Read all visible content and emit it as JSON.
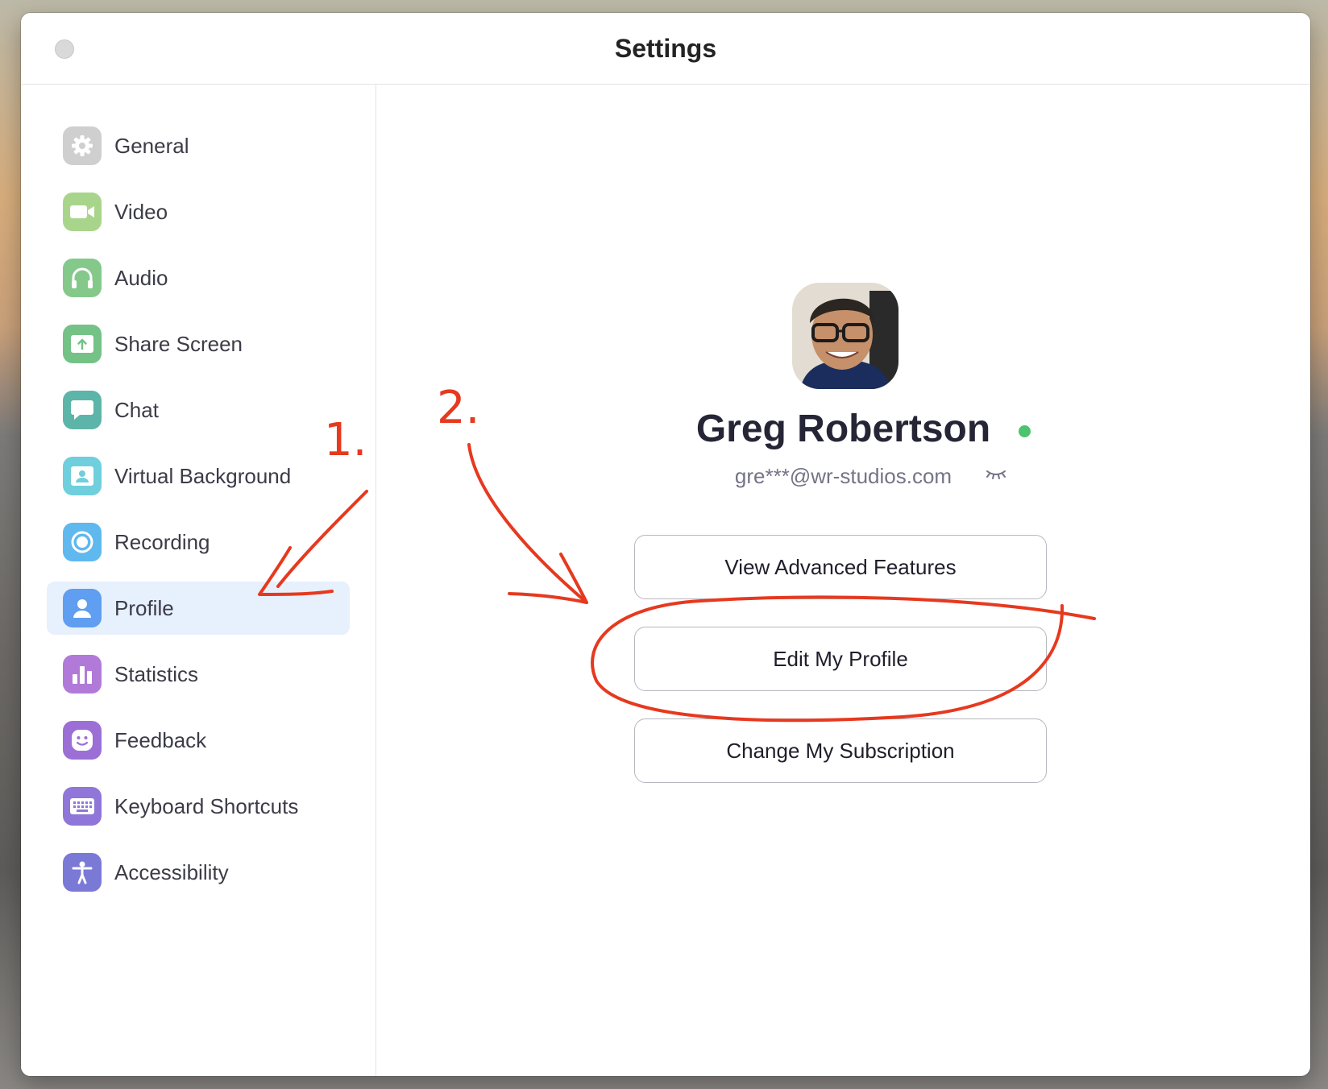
{
  "window": {
    "title": "Settings"
  },
  "sidebar": {
    "items": [
      {
        "label": "General",
        "icon": "gear-icon",
        "color": "#cfcfcf"
      },
      {
        "label": "Video",
        "icon": "video-camera-icon",
        "color": "#a8d58b"
      },
      {
        "label": "Audio",
        "icon": "headphones-icon",
        "color": "#84c98a"
      },
      {
        "label": "Share Screen",
        "icon": "share-screen-icon",
        "color": "#74c286"
      },
      {
        "label": "Chat",
        "icon": "chat-bubble-icon",
        "color": "#5cb5a8"
      },
      {
        "label": "Virtual Background",
        "icon": "virtual-background-icon",
        "color": "#6fcfdc"
      },
      {
        "label": "Recording",
        "icon": "record-icon",
        "color": "#5fb8ee"
      },
      {
        "label": "Profile",
        "icon": "person-icon",
        "color": "#5f9ef0",
        "selected": true
      },
      {
        "label": "Statistics",
        "icon": "bar-chart-icon",
        "color": "#b17ad8"
      },
      {
        "label": "Feedback",
        "icon": "smiley-icon",
        "color": "#9c6fd6"
      },
      {
        "label": "Keyboard Shortcuts",
        "icon": "keyboard-icon",
        "color": "#8f76d8"
      },
      {
        "label": "Accessibility",
        "icon": "accessibility-icon",
        "color": "#7b79d6"
      }
    ]
  },
  "profile": {
    "name": "Greg Robertson",
    "email": "gre***@wr-studios.com",
    "status": "online",
    "status_color": "#4cc36e"
  },
  "buttons": {
    "view_advanced": "View Advanced Features",
    "edit_profile": "Edit My Profile",
    "change_subscription": "Change My Subscription"
  },
  "annotations": {
    "step1": "1.",
    "step2": "2.",
    "color": "#e6391f"
  }
}
